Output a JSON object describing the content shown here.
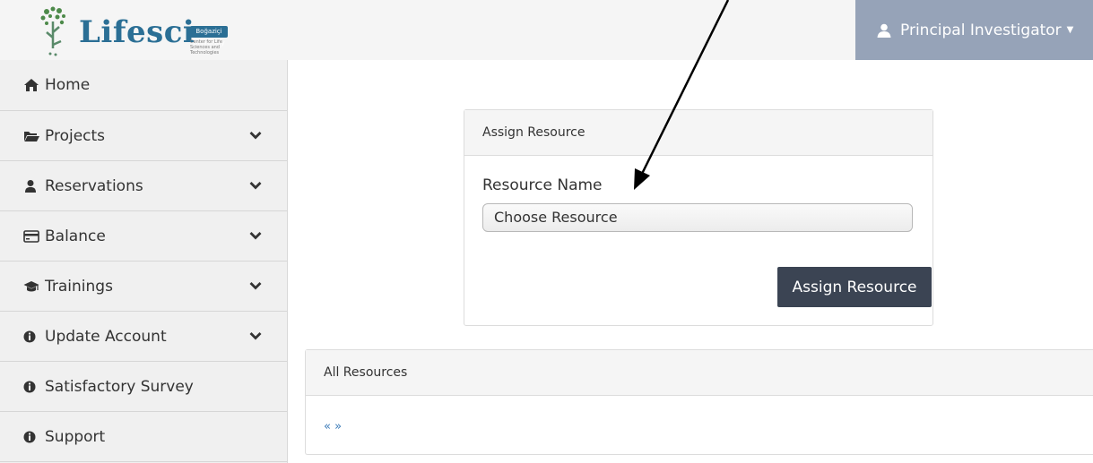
{
  "header": {
    "logo_text": "Lifesci",
    "logo_badge": "Boğaziçi University",
    "logo_subtext": "Center for Life Sciences and Technologies",
    "user_menu_label": "Principal Investigator",
    "user_icon": "user-icon",
    "caret_icon": "caret-down-icon"
  },
  "sidebar": {
    "items": [
      {
        "label": "Home",
        "icon": "home-icon",
        "expandable": false
      },
      {
        "label": "Projects",
        "icon": "folder-open-icon",
        "expandable": true
      },
      {
        "label": "Reservations",
        "icon": "user-icon",
        "expandable": true
      },
      {
        "label": "Balance",
        "icon": "credit-card-icon",
        "expandable": true
      },
      {
        "label": "Trainings",
        "icon": "graduation-cap-icon",
        "expandable": true
      },
      {
        "label": "Update Account",
        "icon": "info-circle-icon",
        "expandable": true
      },
      {
        "label": "Satisfactory Survey",
        "icon": "info-circle-icon",
        "expandable": false
      },
      {
        "label": "Support",
        "icon": "info-circle-icon",
        "expandable": false
      }
    ]
  },
  "assign_panel": {
    "title": "Assign Resource",
    "field_label": "Resource Name",
    "select_value": "Choose Resource",
    "button_label": "Assign Resource"
  },
  "all_resources_panel": {
    "title": "All Resources",
    "pager": "« »"
  },
  "colors": {
    "accent": "#96a3b8",
    "button": "#3b4453",
    "link": "#3a7ab8",
    "logo": "#2b6f95"
  }
}
